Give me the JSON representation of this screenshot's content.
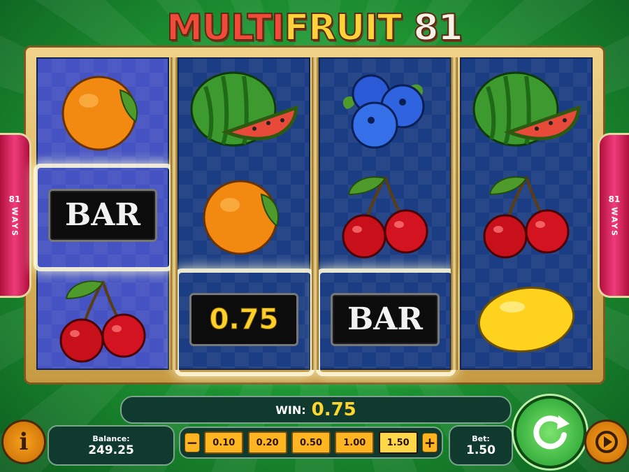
{
  "title": {
    "part1": "MULTI",
    "part2": "FRUIT",
    "part3": "81"
  },
  "ways": {
    "count": "81",
    "label": "WAYS"
  },
  "reels": [
    [
      "orange",
      "BAR",
      "cherries"
    ],
    [
      "watermelon",
      "orange",
      "0.75"
    ],
    [
      "blueberries",
      "cherries",
      "BAR"
    ],
    [
      "watermelon",
      "cherries",
      "lemon"
    ]
  ],
  "symbols": {
    "bar_label": "BAR",
    "coin_value": "0.75"
  },
  "win": {
    "label": "WIN:",
    "value": "0.75"
  },
  "balance": {
    "label": "Balance:",
    "value": "249.25"
  },
  "bet": {
    "label": "Bet:",
    "value": "1.50"
  },
  "bet_options": [
    "0.10",
    "0.20",
    "0.50",
    "1.00",
    "1.50"
  ],
  "selected_bet": "1.50",
  "controls": {
    "minus": "−",
    "plus": "+",
    "info": "i"
  },
  "colors": {
    "win_value": "#ffd530",
    "reel_bg": "#1b3d83",
    "ways_badge": "#e0205e"
  }
}
